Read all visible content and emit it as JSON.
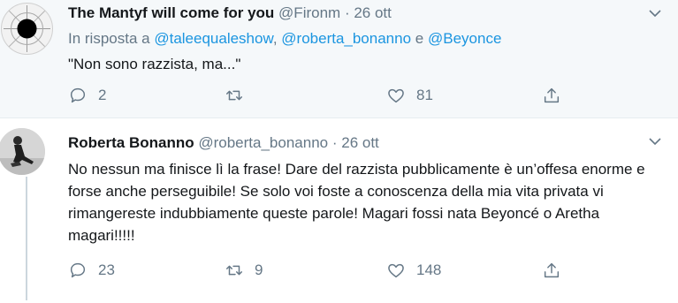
{
  "tweet1": {
    "name": "The Mantyf will come for you",
    "handle": "@Fironm",
    "separator": "·",
    "date": "26 ott",
    "reply_prefix": "In risposta a",
    "mention1": "@taleequaleshow",
    "comma": ",",
    "mention2": "@roberta_bonanno",
    "conjunction": "e",
    "mention3": "@Beyonce",
    "text": "\"Non sono razzista, ma...\"",
    "reply_count": "2",
    "retweet_count": "",
    "like_count": "81"
  },
  "tweet2": {
    "name": "Roberta Bonanno",
    "handle": "@roberta_bonanno",
    "separator": "·",
    "date": "26 ott",
    "text": "No nessun ma finisce lì la frase! Dare del razzista pubblicamente è un’offesa enorme e forse anche perseguibile! Se solo voi foste a conoscenza della mia vita privata vi rimangereste indubbiamente queste parole! Magari fossi nata Beyoncé o Aretha magari!!!!!",
    "reply_count": "23",
    "retweet_count": "9",
    "like_count": "148"
  },
  "colors": {
    "accent": "#1b95e0",
    "secondary_text": "#657786",
    "primary_text": "#14171a",
    "parent_background": "#f5f8fa"
  },
  "icons": [
    "chevron-down-icon",
    "reply-icon",
    "retweet-icon",
    "like-icon",
    "share-icon"
  ]
}
